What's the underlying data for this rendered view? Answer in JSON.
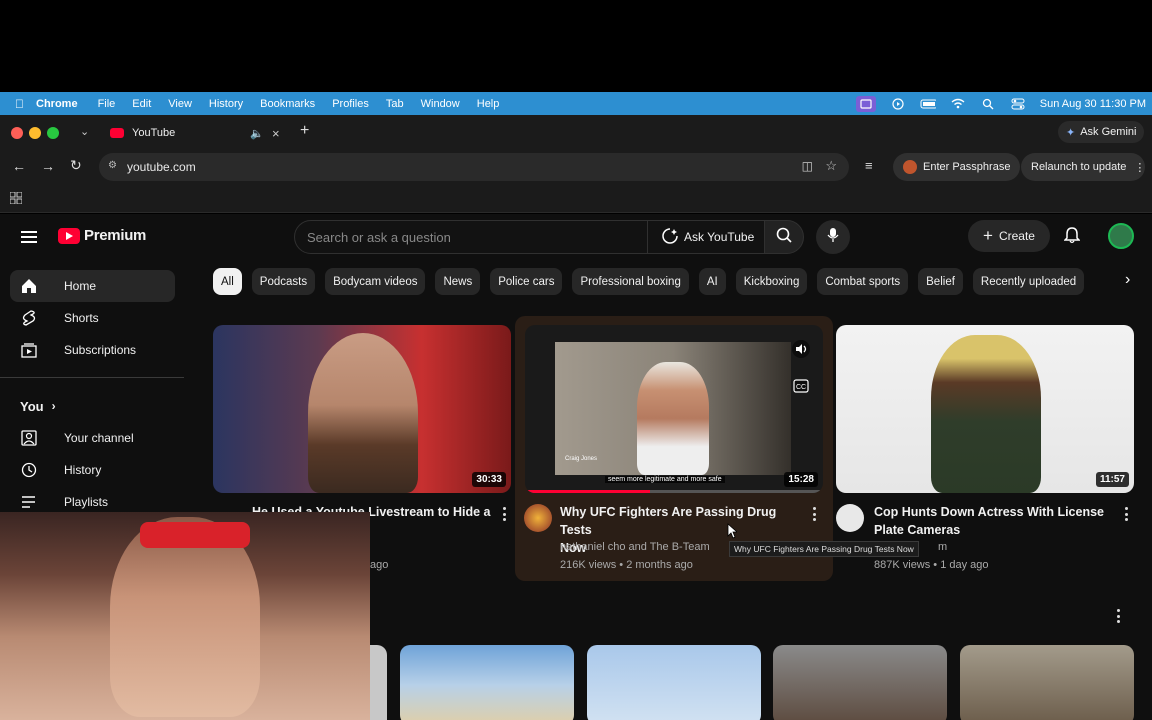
{
  "menubar": {
    "app": "Chrome",
    "items": [
      "File",
      "Edit",
      "View",
      "History",
      "Bookmarks",
      "Profiles",
      "Tab",
      "Window",
      "Help"
    ],
    "clock": "Sun Aug 30  11:30 PM"
  },
  "browser": {
    "tab_title": "YouTube",
    "ask_gemini": "Ask Gemini",
    "url": "youtube.com",
    "enter_passphrase": "Enter Passphrase",
    "relaunch": "Relaunch to update"
  },
  "youtube": {
    "logo_text": "Premium",
    "search_placeholder": "Search or ask a question",
    "ask_label": "Ask YouTube",
    "create_label": "Create",
    "sidebar": {
      "items": [
        {
          "label": "Home",
          "icon": "home-icon"
        },
        {
          "label": "Shorts",
          "icon": "shorts-icon"
        },
        {
          "label": "Subscriptions",
          "icon": "subscriptions-icon"
        }
      ],
      "you_label": "You",
      "you_items": [
        {
          "label": "Your channel",
          "icon": "person-icon"
        },
        {
          "label": "History",
          "icon": "history-icon"
        },
        {
          "label": "Playlists",
          "icon": "playlist-icon"
        }
      ]
    },
    "chips": [
      "All",
      "Podcasts",
      "Bodycam videos",
      "News",
      "Police cars",
      "Professional boxing",
      "AI",
      "Kickboxing",
      "Combat sports",
      "Belief",
      "Recently uploaded"
    ],
    "videos": [
      {
        "title_line1": "He Used a Youtube Livestream to Hide a",
        "title_line2": "",
        "channel": "",
        "meta": "ago",
        "duration": "30:33"
      },
      {
        "title_line1": "Why UFC Fighters Are Passing Drug Tests",
        "title_line2": "Now",
        "channel": "nathaniel cho and The B-Team",
        "meta": "216K views • 2 months ago",
        "duration": "15:28",
        "caption": "seem more legitimate and more safe",
        "overlay_name": "Craig Jones"
      },
      {
        "title_line1": "Cop Hunts Down Actress With License",
        "title_line2": "Plate Cameras",
        "channel": "m",
        "meta": "887K views • 1 day ago",
        "duration": "11:57"
      }
    ],
    "tooltip": "Why UFC Fighters Are Passing Drug Tests Now"
  }
}
